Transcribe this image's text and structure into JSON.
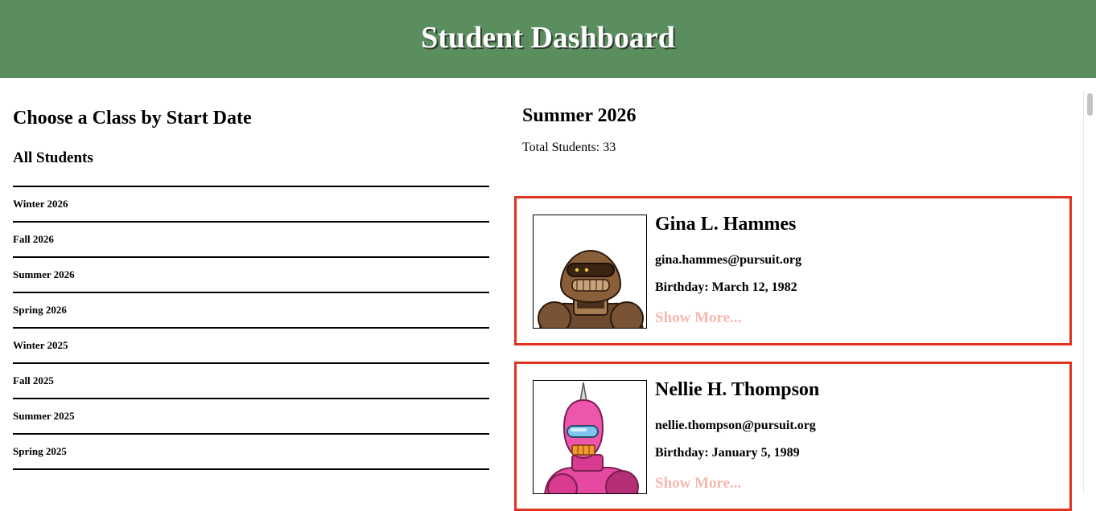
{
  "header": {
    "title": "Student Dashboard"
  },
  "sidebar": {
    "heading": "Choose a Class by Start Date",
    "all_students": "All Students",
    "classes": [
      "Winter 2026",
      "Fall 2026",
      "Summer 2026",
      "Spring 2026",
      "Winter 2025",
      "Fall 2025",
      "Summer 2025",
      "Spring 2025"
    ]
  },
  "main": {
    "class_title": "Summer 2026",
    "total_students": "Total Students: 33",
    "students": [
      {
        "name": "Gina L. Hammes",
        "email": "gina.hammes@pursuit.org",
        "birthday": "Birthday: March 12, 1982",
        "show_more": "Show More...",
        "avatar_icon": "brown-robot-avatar"
      },
      {
        "name": "Nellie H. Thompson",
        "email": "nellie.thompson@pursuit.org",
        "birthday": "Birthday: January 5, 1989",
        "show_more": "Show More...",
        "avatar_icon": "pink-robot-avatar"
      }
    ]
  },
  "colors": {
    "header_bg": "#5b8e5f",
    "card_border": "#e0321f",
    "show_more": "#f6b8ae"
  }
}
